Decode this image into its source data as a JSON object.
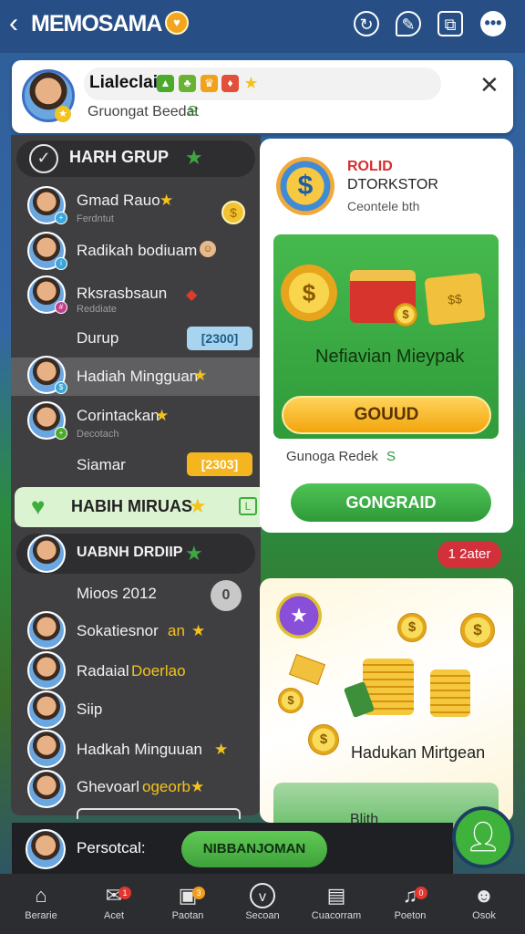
{
  "header": {
    "back_icon": "chevron-left-icon",
    "title": "MEMOSAMA",
    "title_badge": "♥",
    "icons": [
      "sync-icon",
      "chat-icon",
      "copy-icon",
      "more-icon"
    ]
  },
  "profile": {
    "name": "Lialeclai",
    "subtitle": "Gruongat Beedat",
    "subtitle_accent": "S",
    "close": "✕"
  },
  "group1": {
    "title": "HARH GRUP",
    "items": [
      {
        "name": "Gmad Rauo",
        "sub": "Ferdntut"
      },
      {
        "name": "Radikah bodiuam",
        "sub": ""
      },
      {
        "name": "Rksrasbsaun",
        "sub": "Reddiate"
      },
      {
        "name": "Durup",
        "sub": "",
        "pill": "[2300]"
      },
      {
        "name": "Hadiah Mingguan",
        "sub": ""
      },
      {
        "name": "Corintackan",
        "sub": "Decotach"
      },
      {
        "name": "Siamar",
        "sub": "",
        "pill": "[2303]"
      }
    ]
  },
  "weekly_bar": {
    "title": "HABIH MIRUAS"
  },
  "group2": {
    "title": "UABNH DRDIIP",
    "pill": "1 2ater",
    "items": [
      {
        "name": "Mioos 2012"
      },
      {
        "name": "Sokatiesnor",
        "extra": "an"
      },
      {
        "name": "Radaial",
        "extra": "Doerlao"
      },
      {
        "name": "Siip"
      },
      {
        "name": "Hadkah Minguuan"
      },
      {
        "name": "Ghevoarl",
        "extra": "ogeorb"
      }
    ]
  },
  "promo1": {
    "title": "ROLID",
    "subtitle": "DTORKSTOR",
    "desc": "Ceontele bth",
    "green_label": "Nefiavian Mieypak",
    "button": "GOUUD",
    "footer": "Gunoga Redek",
    "footer_accent": "S",
    "button2": "GONGRAID"
  },
  "promo2": {
    "label": "Hadukan Mirtgean",
    "green_text": "Blith"
  },
  "bottom_strip": {
    "name": "Persotcal:",
    "button": "NIBBANJOMAN"
  },
  "nav": [
    {
      "label": "Berarie",
      "icon": "home-icon"
    },
    {
      "label": "Acet",
      "icon": "chat-icon",
      "badge": "1"
    },
    {
      "label": "Paotan",
      "icon": "gift-icon",
      "badge": "3"
    },
    {
      "label": "Secoan",
      "icon": "compass-icon"
    },
    {
      "label": "Cuacorram",
      "icon": "inbox-icon"
    },
    {
      "label": "Poeton",
      "icon": "music-icon",
      "badge": "0"
    },
    {
      "label": "Osok",
      "icon": "user-icon"
    }
  ],
  "colors": {
    "topbar": "#274f86",
    "accent_green": "#3fb23c",
    "accent_gold": "#f4c21d",
    "panel_dark": "#3f3f42",
    "red": "#d2303a"
  }
}
